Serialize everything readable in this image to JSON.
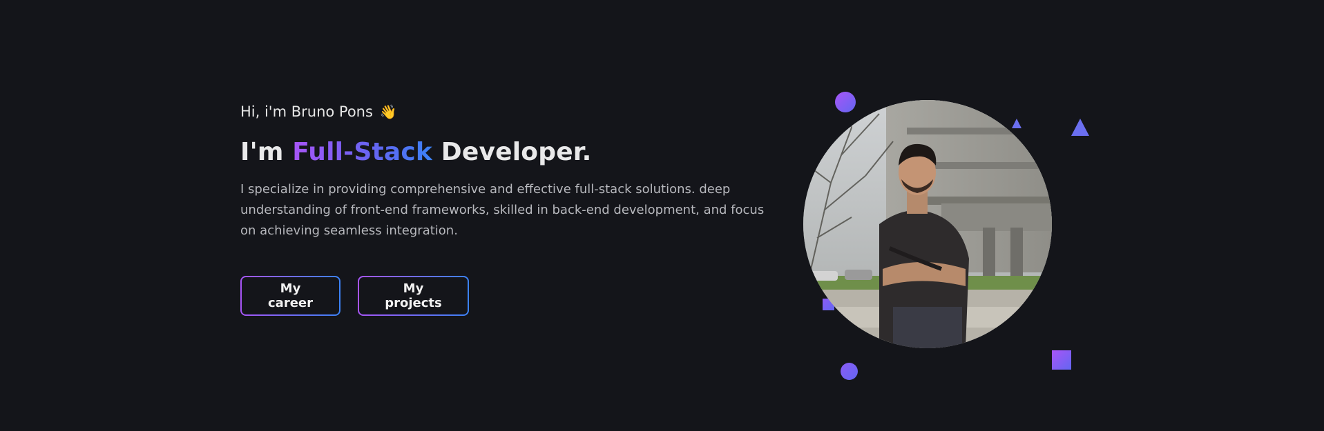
{
  "hero": {
    "greeting": "Hi, i'm Bruno Pons",
    "greeting_emoji": "👋",
    "headline_prefix": "I'm ",
    "headline_highlight": "Full-Stack",
    "headline_suffix": " Developer.",
    "description": "I specialize in providing comprehensive and effective full-stack solutions. deep understanding of front-end frameworks, skilled in back-end development, and focus on achieving seamless integration.",
    "buttons": {
      "career": "My career",
      "projects": "My projects"
    }
  },
  "avatar": {
    "icon": "profile-photo"
  },
  "theme": {
    "background": "#14151a",
    "accent_purple": "#a855f7",
    "accent_blue": "#3b82f6",
    "text_primary": "#e9e9ea",
    "text_secondary": "#b7b8bd"
  }
}
